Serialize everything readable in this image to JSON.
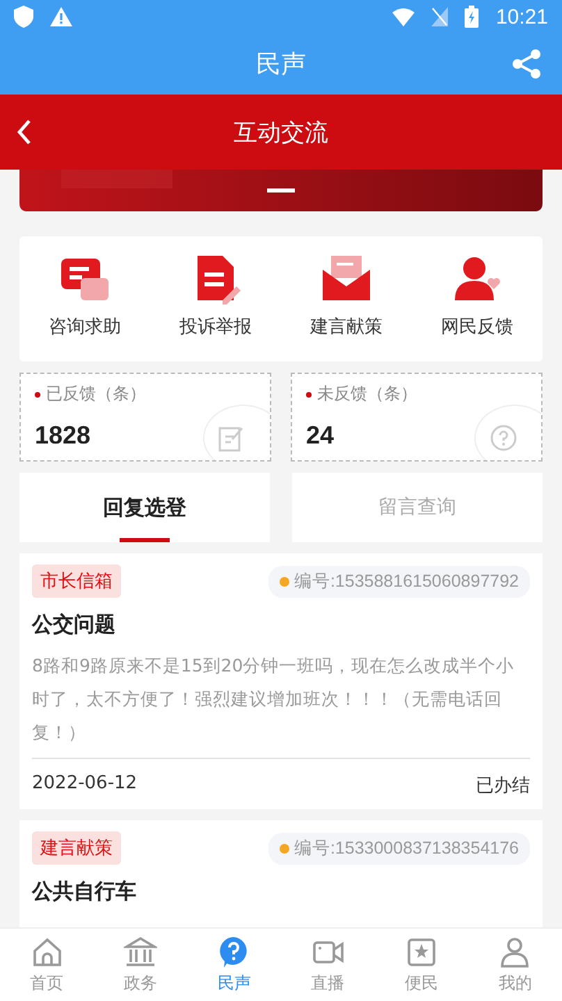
{
  "status_bar": {
    "time": "10:21"
  },
  "header": {
    "title": "民声"
  },
  "subheader": {
    "title": "互动交流"
  },
  "categories": [
    {
      "label": "咨询求助",
      "kind": "chat"
    },
    {
      "label": "投诉举报",
      "kind": "document"
    },
    {
      "label": "建言献策",
      "kind": "mail"
    },
    {
      "label": "网民反馈",
      "kind": "person"
    }
  ],
  "stats": [
    {
      "label": "已反馈（条）",
      "value": "1828",
      "kind": "edit"
    },
    {
      "label": "未反馈（条）",
      "value": "24",
      "kind": "question"
    }
  ],
  "tabs": [
    {
      "label": "回复选登",
      "selected": true
    },
    {
      "label": "留言查询",
      "selected": false
    }
  ],
  "posts": [
    {
      "tag": "市长信箱",
      "number": "编号:1535881615060897792",
      "title": "公交问题",
      "body": "8路和9路原来不是15到20分钟一班吗，现在怎么改成半个小时了，太不方便了！强烈建议增加班次！！！（无需电话回复！）",
      "date": "2022-06-12",
      "status": "已办结"
    },
    {
      "tag": "建言献策",
      "number": "编号:1533000837138354176",
      "title": "公共自行车"
    }
  ],
  "nav": [
    {
      "label": "首页",
      "kind": "home",
      "selected": false
    },
    {
      "label": "政务",
      "kind": "bank",
      "selected": false
    },
    {
      "label": "民声",
      "kind": "question",
      "selected": true
    },
    {
      "label": "直播",
      "kind": "video",
      "selected": false
    },
    {
      "label": "便民",
      "kind": "star",
      "selected": false
    },
    {
      "label": "我的",
      "kind": "person",
      "selected": false
    }
  ]
}
